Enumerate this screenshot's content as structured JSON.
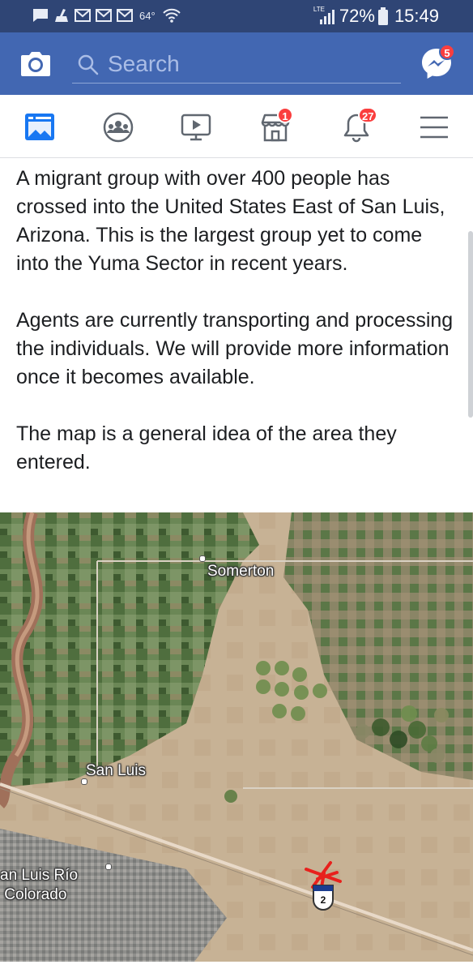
{
  "status_bar": {
    "temperature": "64°",
    "network": "LTE",
    "battery": "72%",
    "time": "15:49"
  },
  "header": {
    "search_placeholder": "Search",
    "messenger_badge": "5"
  },
  "nav": {
    "tabs": [
      {
        "icon": "news-feed-icon",
        "badge": null
      },
      {
        "icon": "groups-icon",
        "badge": null
      },
      {
        "icon": "watch-video-icon",
        "badge": null
      },
      {
        "icon": "marketplace-icon",
        "badge": "1"
      },
      {
        "icon": "notifications-bell-icon",
        "badge": "27"
      },
      {
        "icon": "menu-icon",
        "badge": null
      }
    ]
  },
  "post": {
    "paragraphs": [
      "A migrant group with over 400 people has crossed into the United States East of San Luis, Arizona. This is the largest group yet to come into the Yuma Sector in recent years.",
      "Agents are currently transporting and processing the individuals. We will provide more information once it becomes available.",
      "The map is a general idea of the area they entered."
    ]
  },
  "map": {
    "labels": {
      "somerton": "Somerton",
      "san_luis": "San Luis",
      "san_luis_rio_colorado": "an Luis Río\n Colorado"
    },
    "route_shield": "2",
    "colors": {
      "desert": "#c7b295",
      "farmland": "#5f7f4f",
      "river": "#a0705a",
      "marker": "#e8201c"
    }
  },
  "colors": {
    "status_bar": "#2f4575",
    "header": "#4267b2",
    "badge": "#fa3e3e",
    "icon": "#606770"
  }
}
